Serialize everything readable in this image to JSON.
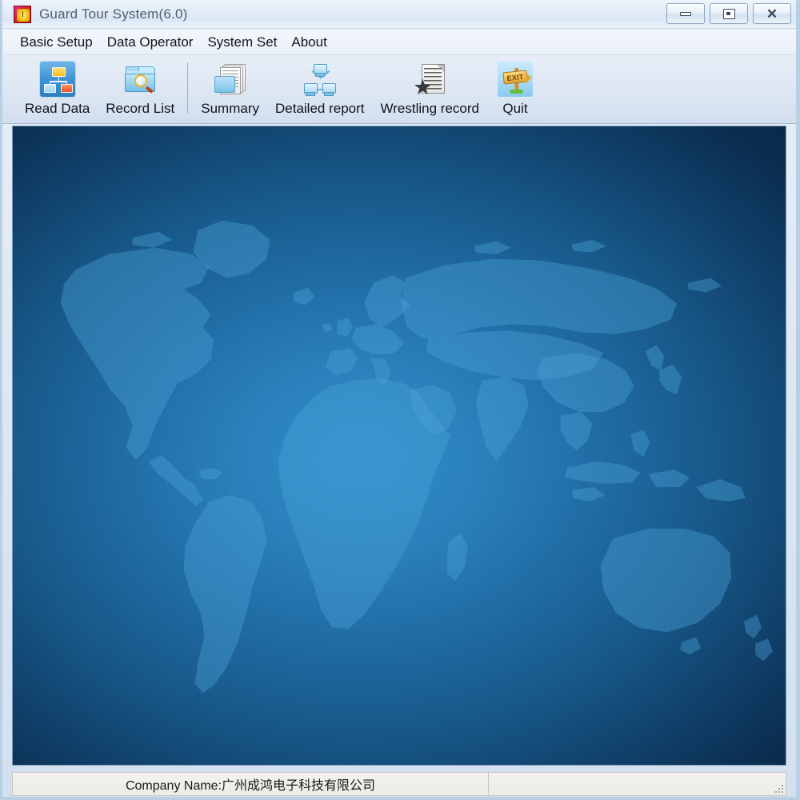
{
  "window": {
    "title": "Guard Tour System(6.0)",
    "app_icon": "clock-icon",
    "controls": {
      "minimize": "minimize-icon",
      "restore": "restore-icon",
      "close": "✕"
    }
  },
  "menubar": {
    "items": [
      {
        "label": "Basic Setup"
      },
      {
        "label": "Data Operator"
      },
      {
        "label": "System Set"
      },
      {
        "label": "About"
      }
    ]
  },
  "toolbar": {
    "buttons": [
      {
        "label": "Read Data",
        "icon": "org-chart-icon"
      },
      {
        "label": "Record List",
        "icon": "folder-search-icon"
      },
      {
        "label": "Summary",
        "icon": "documents-folder-icon"
      },
      {
        "label": "Detailed report",
        "icon": "network-computers-icon"
      },
      {
        "label": "Wrestling record",
        "icon": "starred-document-icon"
      },
      {
        "label": "Quit",
        "icon": "exit-sign-icon"
      }
    ]
  },
  "main": {
    "background": "world-map-image",
    "colors": {
      "ocean_center": "#2f8ecb",
      "ocean_edge": "#0a2a49",
      "land": "#4aa3d8"
    }
  },
  "statusbar": {
    "company_label": "Company Name:广州成鸿电子科技有限公司",
    "resize_grip": "resize-grip-icon"
  },
  "quit_icon_text": "EXIT"
}
